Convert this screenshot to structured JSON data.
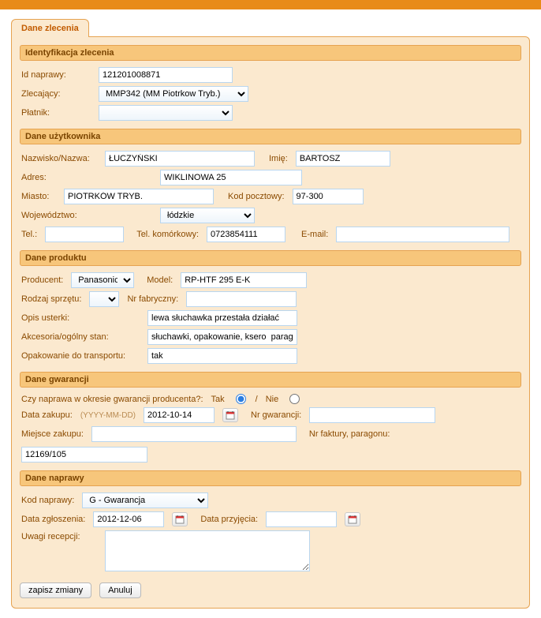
{
  "tab_label": "Dane zlecenia",
  "sections": {
    "ident": {
      "title": "Identyfikacja zlecenia",
      "id_naprawy_label": "Id naprawy:",
      "id_naprawy": "121201008871",
      "zlecajacy_label": "Zlecający:",
      "zlecajacy": "MMP342 (MM Piotrkow Tryb.)",
      "platnik_label": "Płatnik:",
      "platnik": ""
    },
    "user": {
      "title": "Dane użytkownika",
      "nazwisko_label": "Nazwisko/Nazwa:",
      "nazwisko": "ŁUCZYŃSKI",
      "imie_label": "Imię:",
      "imie": "BARTOSZ",
      "adres_label": "Adres:",
      "adres": "WIKLINOWA 25",
      "miasto_label": "Miasto:",
      "miasto": "PIOTRKÓW TRYB.",
      "kod_label": "Kod pocztowy:",
      "kod": "97-300",
      "woj_label": "Województwo:",
      "woj": "łódzkie",
      "tel_label": "Tel.:",
      "tel": "",
      "kom_label": "Tel. komórkowy:",
      "kom": "0723854111",
      "email_label": "E-mail:",
      "email": ""
    },
    "product": {
      "title": "Dane produktu",
      "producent_label": "Producent:",
      "producent": "Panasonic",
      "model_label": "Model:",
      "model": "RP-HTF 295 E-K",
      "rodzaj_label": "Rodzaj sprzętu:",
      "rodzaj": "",
      "nrfab_label": "Nr fabryczny:",
      "nrfab": "",
      "opis_label": "Opis usterki:",
      "opis": "lewa słuchawka przestała działać",
      "akcesoria_label": "Akcesoria/ogólny stan:",
      "akcesoria": "słuchawki, opakowanie, ksero  parag",
      "opak_label": "Opakowanie do transportu:",
      "opak": "tak"
    },
    "warranty": {
      "title": "Dane gwarancji",
      "okres_label": "Czy naprawa w okresie gwarancji producenta?:",
      "tak": "Tak",
      "nie": "Nie",
      "sep": "/",
      "okres_value": "tak",
      "data_zakupu_label": "Data zakupu:",
      "data_zakupu_hint": "(YYYY-MM-DD)",
      "data_zakupu": "2012-10-14",
      "nrgw_label": "Nr gwarancji:",
      "nrgw": "",
      "miejsce_label": "Miejsce zakupu:",
      "miejsce": "",
      "nrfakt_label": "Nr faktury, paragonu:",
      "nrfakt": "12169/105"
    },
    "repair": {
      "title": "Dane naprawy",
      "kod_label": "Kod naprawy:",
      "kod": "G - Gwarancja",
      "data_zg_label": "Data zgłoszenia:",
      "data_zg": "2012-12-06",
      "data_pr_label": "Data przyjęcia:",
      "data_pr": "",
      "uwagi_label": "Uwagi recepcji:",
      "uwagi": ""
    }
  },
  "buttons": {
    "save": "zapisz zmiany",
    "cancel": "Anuluj"
  }
}
